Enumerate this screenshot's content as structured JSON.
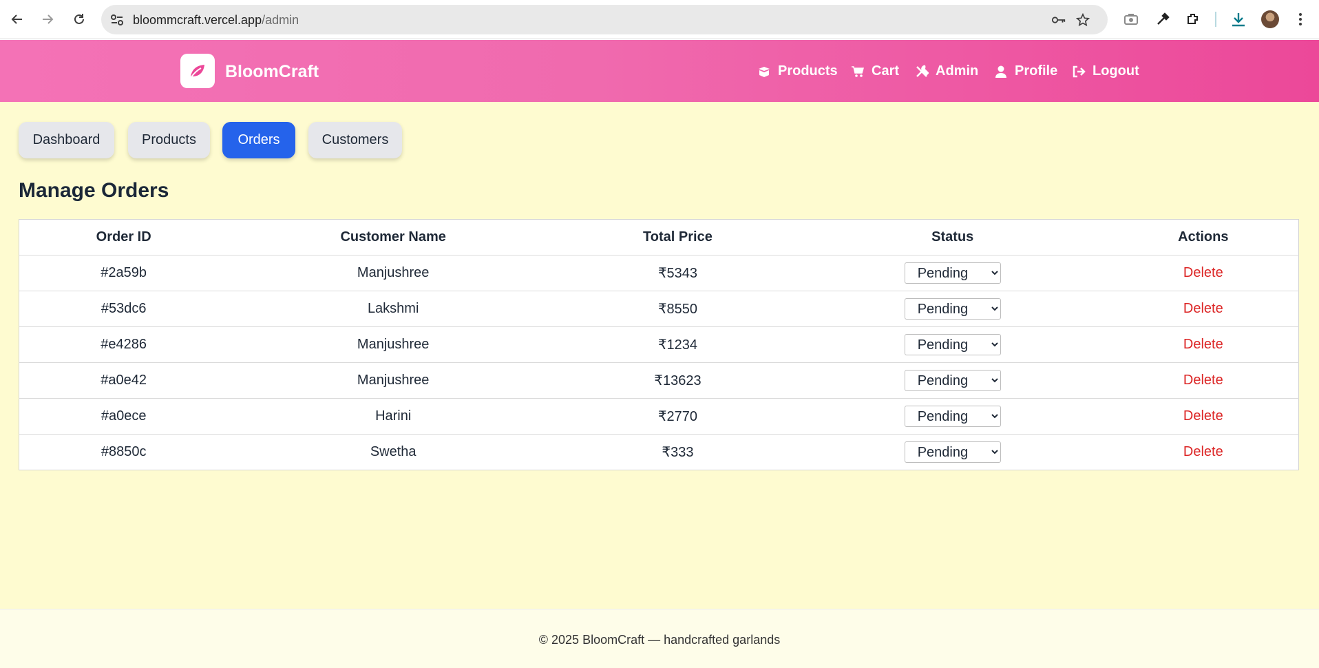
{
  "browser": {
    "url_host": "bloommcraft.vercel.app",
    "url_path": "/admin"
  },
  "header": {
    "brand": "BloomCraft",
    "nav": [
      {
        "label": "Products",
        "icon": "box-open-icon"
      },
      {
        "label": "Cart",
        "icon": "cart-icon"
      },
      {
        "label": "Admin",
        "icon": "tools-icon"
      },
      {
        "label": "Profile",
        "icon": "user-icon"
      },
      {
        "label": "Logout",
        "icon": "logout-icon"
      }
    ]
  },
  "tabs": [
    {
      "label": "Dashboard",
      "active": false
    },
    {
      "label": "Products",
      "active": false
    },
    {
      "label": "Orders",
      "active": true
    },
    {
      "label": "Customers",
      "active": false
    }
  ],
  "page_title": "Manage Orders",
  "table": {
    "headers": [
      "Order ID",
      "Customer Name",
      "Total Price",
      "Status",
      "Actions"
    ],
    "rows": [
      {
        "id": "#2a59b",
        "customer": "Manjushree",
        "total": "₹5343",
        "status": "Pending",
        "action": "Delete"
      },
      {
        "id": "#53dc6",
        "customer": "Lakshmi",
        "total": "₹8550",
        "status": "Pending",
        "action": "Delete"
      },
      {
        "id": "#e4286",
        "customer": "Manjushree",
        "total": "₹1234",
        "status": "Pending",
        "action": "Delete"
      },
      {
        "id": "#a0e42",
        "customer": "Manjushree",
        "total": "₹13623",
        "status": "Pending",
        "action": "Delete"
      },
      {
        "id": "#a0ece",
        "customer": "Harini",
        "total": "₹2770",
        "status": "Pending",
        "action": "Delete"
      },
      {
        "id": "#8850c",
        "customer": "Swetha",
        "total": "₹333",
        "status": "Pending",
        "action": "Delete"
      }
    ]
  },
  "footer": {
    "text": "© 2025 BloomCraft — handcrafted garlands"
  },
  "colors": {
    "header_start": "#f472b6",
    "header_end": "#ec4899",
    "main_bg": "#fefbd0",
    "active_tab": "#2563eb",
    "delete": "#dc2626"
  }
}
